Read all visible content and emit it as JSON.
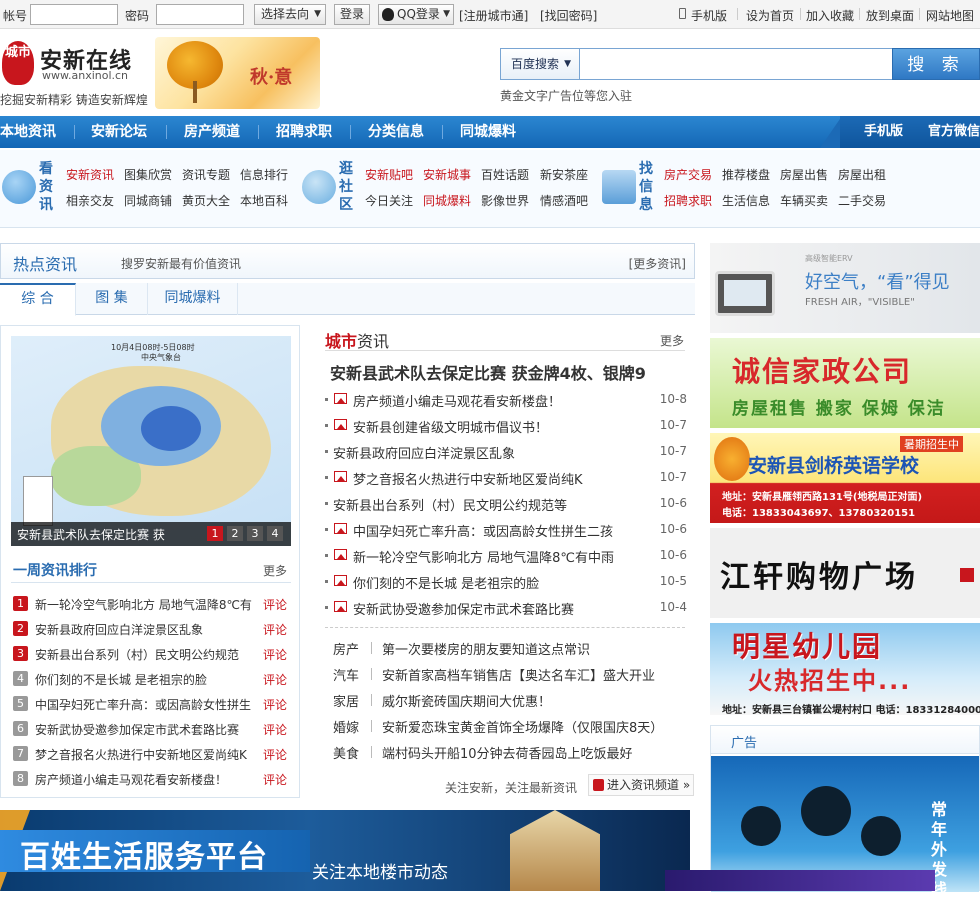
{
  "topbar": {
    "account_label": "帐号",
    "password_label": "密码",
    "select_label": "选择去向",
    "login_label": "登录",
    "qq_label": "QQ登录",
    "register_label": "[注册城市通]",
    "recover_label": "[找回密码]",
    "mobile_label": "手机版",
    "homepage_label": "设为首页",
    "favorite_label": "加入收藏",
    "desktop_label": "放到桌面",
    "sitemap_label": "网站地图"
  },
  "header": {
    "logo_mark": "城市",
    "logo_name": "安新在线",
    "logo_url": "www.anxinol.cn",
    "slogan": "挖掘安新精彩 铸造安新辉煌",
    "season_title": "秋·意",
    "search_select": "百度搜索",
    "search_button": "搜 索",
    "ad_text": "黄金文字广告位等您入驻"
  },
  "mainnav": {
    "items": [
      "本地资讯",
      "安新论坛",
      "房产频道",
      "招聘求职",
      "分类信息",
      "同城爆料"
    ],
    "right": [
      "手机版",
      "官方微信"
    ]
  },
  "subnav": {
    "groups": [
      {
        "title": "看资讯",
        "row1": [
          "安新资讯",
          "图集欣赏",
          "资讯专题",
          "信息排行"
        ],
        "row2": [
          "相亲交友",
          "同城商铺",
          "黄页大全",
          "本地百科"
        ]
      },
      {
        "title": "逛社区",
        "row1": [
          "安新贴吧",
          "安新城事",
          "百姓话题",
          "新安茶座"
        ],
        "row2": [
          "今日关注",
          "同城爆料",
          "影像世界",
          "情感酒吧"
        ]
      },
      {
        "title": "找信息",
        "row1": [
          "房产交易",
          "推荐楼盘",
          "房屋出售",
          "房屋出租"
        ],
        "row2": [
          "招聘求职",
          "生活信息",
          "车辆买卖",
          "二手交易"
        ]
      }
    ]
  },
  "hot": {
    "title": "热点资讯",
    "subtitle": "搜罗安新最有价值资讯",
    "more": "[更多资讯]",
    "tabs": [
      "综 合",
      "图 集",
      "同城爆料"
    ]
  },
  "map": {
    "title": "10月4日08时-5日08时",
    "source": "中央气象台",
    "caption": "安新县武术队去保定比赛 获",
    "pages": [
      "1",
      "2",
      "3",
      "4"
    ]
  },
  "week": {
    "title": "一周资讯排行",
    "more": "更多",
    "comment": "评论",
    "items": [
      "新一轮冷空气影响北方 局地气温降8℃有",
      "安新县政府回应白洋淀景区乱象",
      "安新县出台系列（村）民文明公约规范",
      "你们刻的不是长城 是老祖宗的脸",
      "中国孕妇死亡率升高：或因高龄女性拼生",
      "安新武协受邀参加保定市武术套路比赛",
      "梦之音报名火热进行中安新地区爱尚纯K",
      "房产频道小编走马观花看安新楼盘！"
    ]
  },
  "city": {
    "title_a": "城市",
    "title_b": "资讯",
    "more": "更多",
    "headline": "安新县武术队去保定比赛 获金牌4枚、银牌9",
    "news": [
      {
        "title": "房产频道小编走马观花看安新楼盘！",
        "date": "10-8",
        "pic": true
      },
      {
        "title": "安新县创建省级文明城市倡议书！",
        "date": "10-7",
        "pic": true
      },
      {
        "title": "安新县政府回应白洋淀景区乱象",
        "date": "10-7",
        "pic": false
      },
      {
        "title": "梦之音报名火热进行中安新地区爱尚纯K",
        "date": "10-7",
        "pic": true
      },
      {
        "title": "安新县出台系列（村）民文明公约规范等",
        "date": "10-6",
        "pic": false
      },
      {
        "title": "中国孕妇死亡率升高：或因高龄女性拼生二孩",
        "date": "10-6",
        "pic": true
      },
      {
        "title": "新一轮冷空气影响北方 局地气温降8℃有中雨",
        "date": "10-6",
        "pic": true
      },
      {
        "title": "你们刻的不是长城 是老祖宗的脸",
        "date": "10-5",
        "pic": true
      },
      {
        "title": "安新武协受邀参加保定市武术套路比赛",
        "date": "10-4",
        "pic": true
      }
    ],
    "categories": [
      {
        "key": "房产",
        "title": "第一次要楼房的朋友要知道这点常识"
      },
      {
        "key": "汽车",
        "title": "安新首家高档车销售店【奥达名车汇】盛大开业"
      },
      {
        "key": "家居",
        "title": "威尔斯瓷砖国庆期间大优惠！"
      },
      {
        "key": "婚嫁",
        "title": "安新爱恋珠宝黄金首饰全场爆降（仅限国庆8天）"
      },
      {
        "key": "美食",
        "title": "端村码头开船10分钟去荷香园岛上吃饭最好"
      }
    ],
    "follow": "关注安新，关注最新资讯",
    "enter": "进入资讯频道 »"
  },
  "ads": {
    "ad1_small": "高级智能ERV",
    "ad1_title": "好空气，“看”得见",
    "ad1_sub": "FRESH AIR，\"VISIBLE\"",
    "ad2_title": "诚信家政公司",
    "ad2_sub": "房屋租售 搬家 保姆 保洁",
    "ad3_tag": "暑期招生中",
    "ad3_title": "安新县剑桥英语学校",
    "ad3_addr": "地址：安新县雁翎西路131号(地税局正对面)",
    "ad3_tel": "电话：13833043697、13780320151",
    "ad4_title": "江轩购物广场",
    "ad5_title": "明星幼儿园",
    "ad5_sub": "火热招生中...",
    "ad5_addr": "地址：安新县三台镇崔公堤村村口 电话：18331284000",
    "guanggao": "广告",
    "gg_vertical": "常年外发线路"
  },
  "banner": {
    "title": "百姓生活服务平台",
    "sub": "关注本地楼市动态"
  }
}
